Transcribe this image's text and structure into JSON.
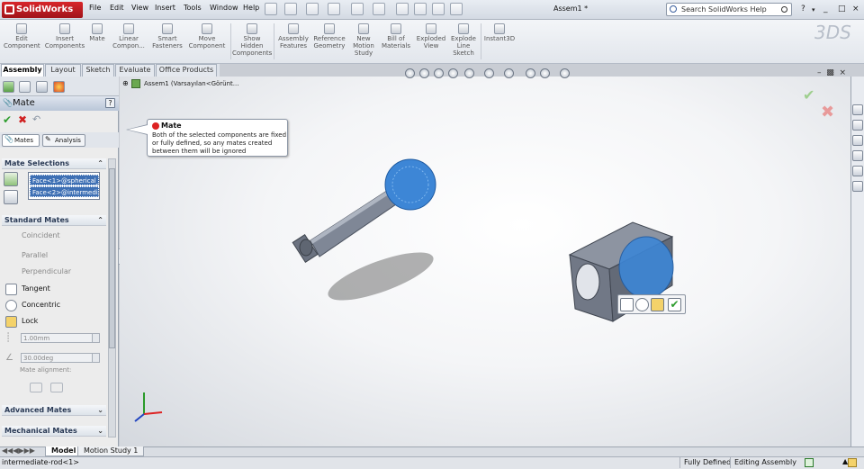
{
  "titlebar": {
    "logo_text": "SolidWorks",
    "menus": [
      "File",
      "Edit",
      "View",
      "Insert",
      "Tools",
      "Window",
      "Help"
    ],
    "doc_title": "Assem1 *",
    "search_placeholder": "Search SolidWorks Help",
    "help_label": "?",
    "window_controls": [
      "_",
      "□",
      "×"
    ]
  },
  "commandmanager": {
    "tools": [
      {
        "label": "Edit Component",
        "icon": "edit-component-icon"
      },
      {
        "label": "Insert Components",
        "icon": "insert-components-icon"
      },
      {
        "label": "Mate",
        "icon": "mate-icon"
      },
      {
        "label": "Linear Compon...",
        "icon": "linear-pattern-icon"
      },
      {
        "label": "Smart Fasteners",
        "icon": "smart-fasteners-icon"
      },
      {
        "label": "Move Component",
        "icon": "move-component-icon"
      },
      {
        "label": "Show Hidden Components",
        "icon": "show-hidden-icon"
      },
      {
        "label": "Assembly Features",
        "icon": "assembly-features-icon"
      },
      {
        "label": "Reference Geometry",
        "icon": "reference-geometry-icon"
      },
      {
        "label": "New Motion Study",
        "icon": "motion-study-icon"
      },
      {
        "label": "Bill of Materials",
        "icon": "bom-icon"
      },
      {
        "label": "Exploded View",
        "icon": "exploded-view-icon"
      },
      {
        "label": "Explode Line Sketch",
        "icon": "explode-line-icon"
      },
      {
        "label": "Instant3D",
        "icon": "instant3d-icon"
      }
    ]
  },
  "tabs": [
    "Assembly",
    "Layout",
    "Sketch",
    "Evaluate",
    "Office Products"
  ],
  "tree": {
    "root": "Assem1  (Varsayılan<Görünt..."
  },
  "propertymanager": {
    "title": "Mate",
    "help": "?",
    "subtabs": [
      "Mates",
      "Analysis"
    ],
    "mate_selections_title": "Mate Selections",
    "selections": [
      "Face<1>@spherical_jo",
      "Face<2>@intermediat"
    ],
    "standard_mates_title": "Standard Mates",
    "mates": [
      {
        "label": "Coincident",
        "enabled": false
      },
      {
        "label": "Parallel",
        "enabled": false
      },
      {
        "label": "Perpendicular",
        "enabled": false
      },
      {
        "label": "Tangent",
        "enabled": true
      },
      {
        "label": "Concentric",
        "enabled": true
      },
      {
        "label": "Lock",
        "enabled": true
      }
    ],
    "distance_value": "1.00mm",
    "angle_value": "30.00deg",
    "mate_alignment_label": "Mate alignment:",
    "advanced_title": "Advanced Mates",
    "mechanical_title": "Mechanical Mates"
  },
  "callout": {
    "title": "Mate",
    "body": "Both of the selected components are fixed or fully defined, so any mates created between them will be ignored"
  },
  "bottom_tabs": [
    "Model",
    "Motion Study 1"
  ],
  "status": {
    "left": "intermediate-rod<1>",
    "fully_defined": "Fully Defined",
    "editing": "Editing Assembly"
  },
  "colors": {
    "selection_blue": "#3d6fb4",
    "logo_red": "#c0161b",
    "ok_green": "#2e9d2e",
    "cancel_red": "#d02020"
  }
}
